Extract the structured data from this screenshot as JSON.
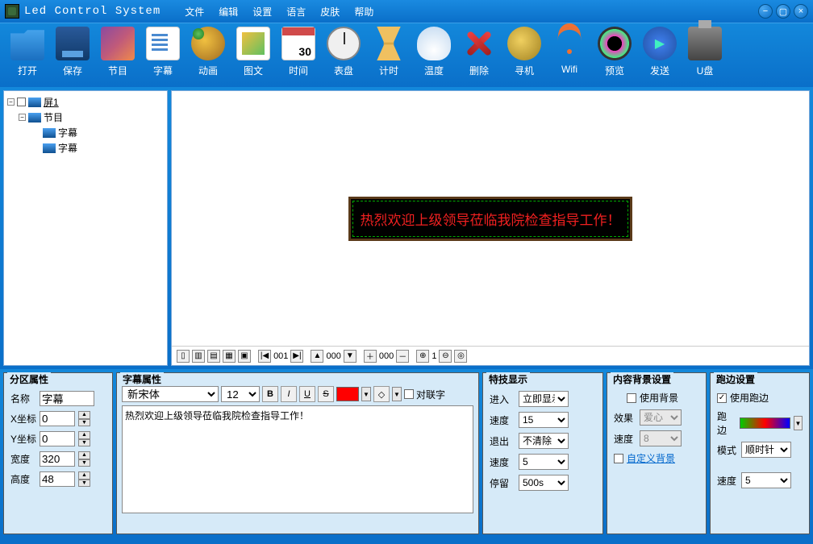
{
  "app": {
    "title": "Led Control System"
  },
  "menu": [
    "文件",
    "编辑",
    "设置",
    "语言",
    "皮肤",
    "帮助"
  ],
  "toolbar": [
    {
      "label": "打开"
    },
    {
      "label": "保存"
    },
    {
      "label": "节目"
    },
    {
      "label": "字幕"
    },
    {
      "label": "动画"
    },
    {
      "label": "图文"
    },
    {
      "label": "时间"
    },
    {
      "label": "表盘"
    },
    {
      "label": "计时"
    },
    {
      "label": "温度"
    },
    {
      "label": "删除"
    },
    {
      "label": "寻机"
    },
    {
      "label": "Wifi"
    },
    {
      "label": "预览"
    },
    {
      "label": "发送"
    },
    {
      "label": "U盘"
    }
  ],
  "tree": {
    "screen": "屏1",
    "program": "节目",
    "sub1": "字幕",
    "sub2": "字幕"
  },
  "led_text": "热烈欢迎上级领导莅临我院检查指导工作！",
  "preview_ctrl": {
    "seq": "001",
    "mid": "000",
    "zoom": "000",
    "one": "1"
  },
  "zone": {
    "title": "分区属性",
    "name_label": "名称",
    "name": "字幕",
    "x_label": "X坐标",
    "x": "0",
    "y_label": "Y坐标",
    "y": "0",
    "w_label": "宽度",
    "w": "320",
    "h_label": "高度",
    "h": "48"
  },
  "sub": {
    "title": "字幕属性",
    "font": "新宋体",
    "size": "12",
    "pair": "对联字",
    "text": "热烈欢迎上级领导莅临我院检查指导工作！"
  },
  "effect": {
    "title": "特技显示",
    "in_l": "进入",
    "in_v": "立即显示",
    "s1_l": "速度",
    "s1_v": "15",
    "out_l": "退出",
    "out_v": "不清除",
    "s2_l": "速度",
    "s2_v": "5",
    "stop_l": "停留",
    "stop_v": "500s"
  },
  "bg": {
    "title": "内容背景设置",
    "use": "使用背景",
    "fx_l": "效果",
    "fx_v": "爱心",
    "sp_l": "速度",
    "sp_v": "8",
    "custom": "自定义背景"
  },
  "border": {
    "title": "跑边设置",
    "use": "使用跑边",
    "b_l": "跑边",
    "mode_l": "模式",
    "mode_v": "顺时针",
    "sp_l": "速度",
    "sp_v": "5"
  }
}
